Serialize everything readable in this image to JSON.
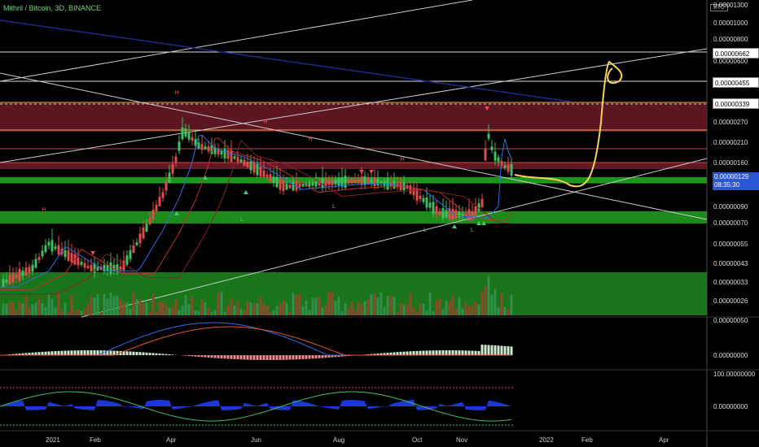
{
  "header": {
    "title": "Mithril / Bitcoin, 3D, BINANCE",
    "currency_badge": "BTC"
  },
  "colors": {
    "background": "#000000",
    "up": "#3fbf5f",
    "down": "#e24b4b",
    "ma_blue": "#2c6ee8",
    "ma_red": "#c0302f",
    "arrow_gold": "#f5d35a",
    "zone_red": "#7a1e2c",
    "zone_green": "#1f8a1f"
  },
  "price_axis_labels": [
    "0.00001300",
    "0.00001000",
    "0.00000800",
    "0.00000600",
    "0.00000270",
    "0.00000210",
    "0.00000160",
    "0.00000090",
    "0.00000070",
    "0.00000055",
    "0.00000043",
    "0.00000033",
    "0.00000026",
    "0.00000050"
  ],
  "price_levels": [
    {
      "label": "0.00000662"
    },
    {
      "label": "0.00000455"
    },
    {
      "label": "0.00000339"
    },
    {
      "label": "0.00000129",
      "sub": "08:35:30",
      "current": true
    }
  ],
  "macd_axis": {
    "labels": [
      "0.00000000"
    ]
  },
  "osc_axis": {
    "labels": [
      "100.00000000",
      "0.00000000"
    ]
  },
  "time_axis": {
    "labels": [
      "2021",
      "Feb",
      "Apr",
      "Jun",
      "Aug",
      "Oct",
      "Nov",
      "2022",
      "Feb",
      "Apr"
    ]
  },
  "markers": {
    "high_label": "H",
    "low_label": "L"
  },
  "chart_data": {
    "type": "candlestick",
    "symbol": "Mithril / Bitcoin",
    "interval": "3D",
    "exchange": "BINANCE",
    "current_price": "0.00000129",
    "countdown": "08:35:30",
    "horizontal_levels": [
      "0.00000662",
      "0.00000455",
      "0.00000339"
    ],
    "x_axis_labels": [
      "2021",
      "Feb",
      "Apr",
      "Jun",
      "Aug",
      "Oct",
      "Nov",
      "2022",
      "Feb",
      "Apr"
    ],
    "y_axis_labels": [
      "0.00001300",
      "0.00001000",
      "0.00000800",
      "0.00000600",
      "0.00000270",
      "0.00000210",
      "0.00000160",
      "0.00000090",
      "0.00000070",
      "0.00000055",
      "0.00000043",
      "0.00000033",
      "0.00000026",
      "0.00000050"
    ],
    "panels": [
      "price",
      "volume",
      "macd",
      "oscillator"
    ]
  }
}
